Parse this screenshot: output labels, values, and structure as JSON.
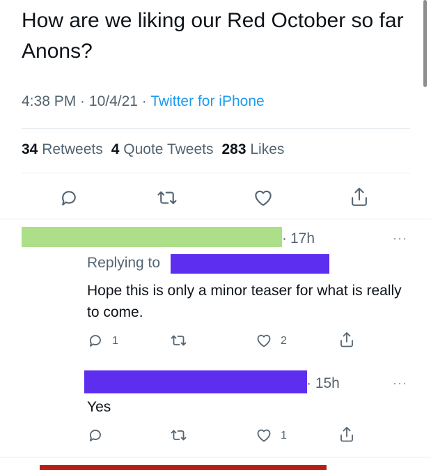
{
  "tweet": {
    "text": "How are we liking our Red October so far Anons?",
    "time": "4:38 PM",
    "date": "10/4/21",
    "source": "Twitter for iPhone",
    "sep": " · "
  },
  "stats": {
    "retweets_count": "34",
    "retweets_label": "Retweets",
    "quotes_count": "4",
    "quotes_label": "Quote Tweets",
    "likes_count": "283",
    "likes_label": "Likes"
  },
  "reply1": {
    "time": "17h",
    "replying_label": "Replying to",
    "text": "Hope this is only a minor teaser for what is really to come.",
    "reply_count": "1",
    "like_count": "2",
    "more": "···"
  },
  "reply2": {
    "time": "· 15h",
    "text": "Yes",
    "like_count": "1",
    "more": "···"
  },
  "colors": {
    "link": "#1d9bf0",
    "muted": "#536471",
    "redaction_green": "#acdf88",
    "redaction_purple": "#5d2ef0",
    "redaction_red": "#b41e14"
  },
  "icons": [
    "reply-icon",
    "retweet-icon",
    "like-icon",
    "share-icon",
    "more-icon"
  ]
}
